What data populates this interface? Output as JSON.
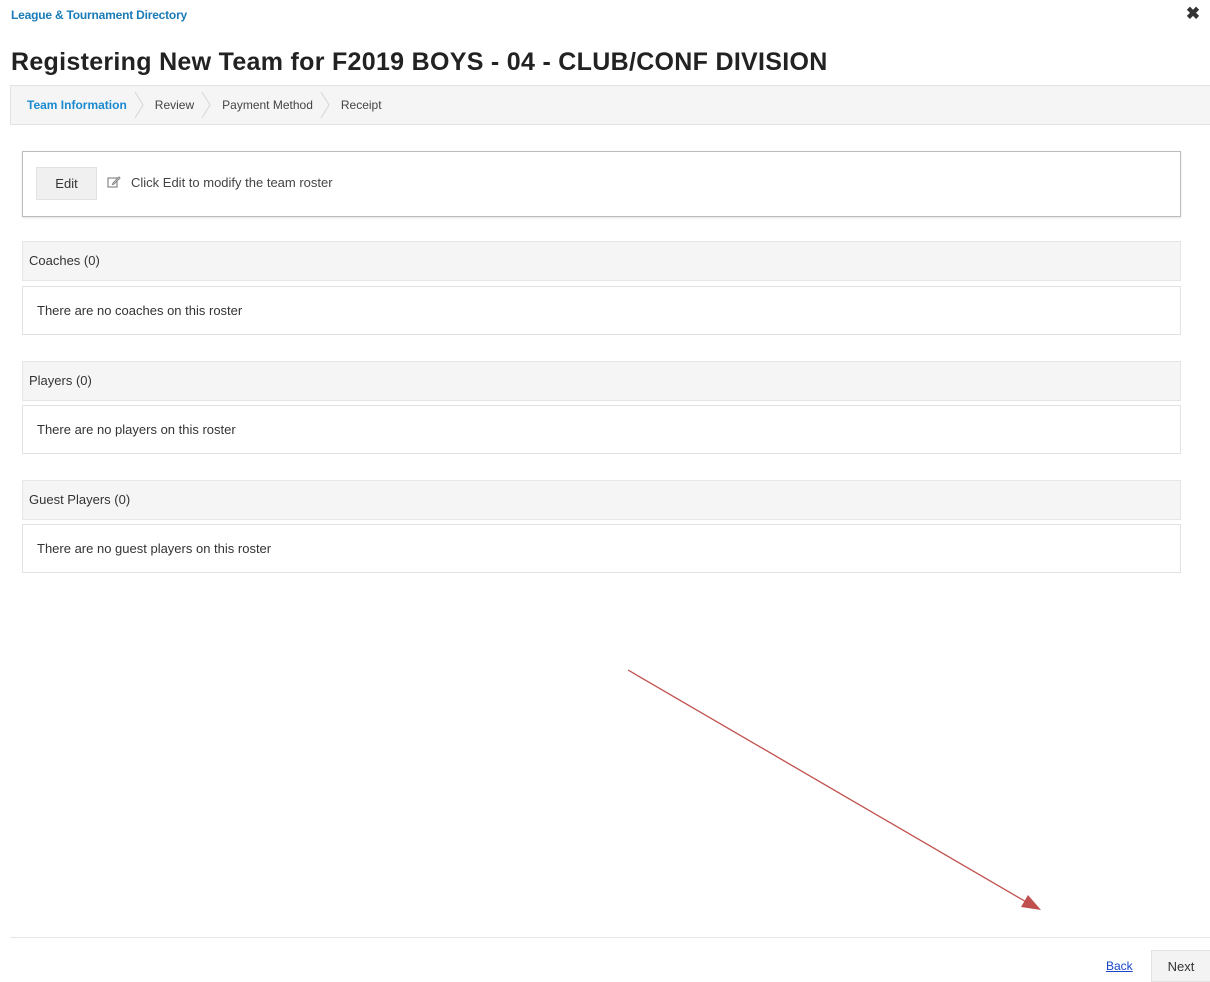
{
  "header": {
    "app_title": "League & Tournament Directory",
    "close_symbol": "✖"
  },
  "page_title": "Registering New Team for F2019 BOYS - 04 - CLUB/CONF DIVISION",
  "wizard": {
    "steps": [
      {
        "label": "Team Information",
        "active": true
      },
      {
        "label": "Review",
        "active": false
      },
      {
        "label": "Payment Method",
        "active": false
      },
      {
        "label": "Receipt",
        "active": false
      }
    ]
  },
  "edit_panel": {
    "edit_label": "Edit",
    "hint_icon": "edit-icon",
    "hint_text": "Click Edit to modify the team roster"
  },
  "sections": [
    {
      "title": "Coaches (0)",
      "empty_text": "There are no coaches on this roster"
    },
    {
      "title": "Players (0)",
      "empty_text": "There are no players on this roster"
    },
    {
      "title": "Guest Players (0)",
      "empty_text": "There are no guest players on this roster"
    }
  ],
  "footer": {
    "back_label": "Back",
    "next_label": "Next"
  },
  "colors": {
    "link_blue": "#1a7bb9",
    "active_step": "#1a8ad0",
    "annotation_arrow": "#c0504d"
  }
}
